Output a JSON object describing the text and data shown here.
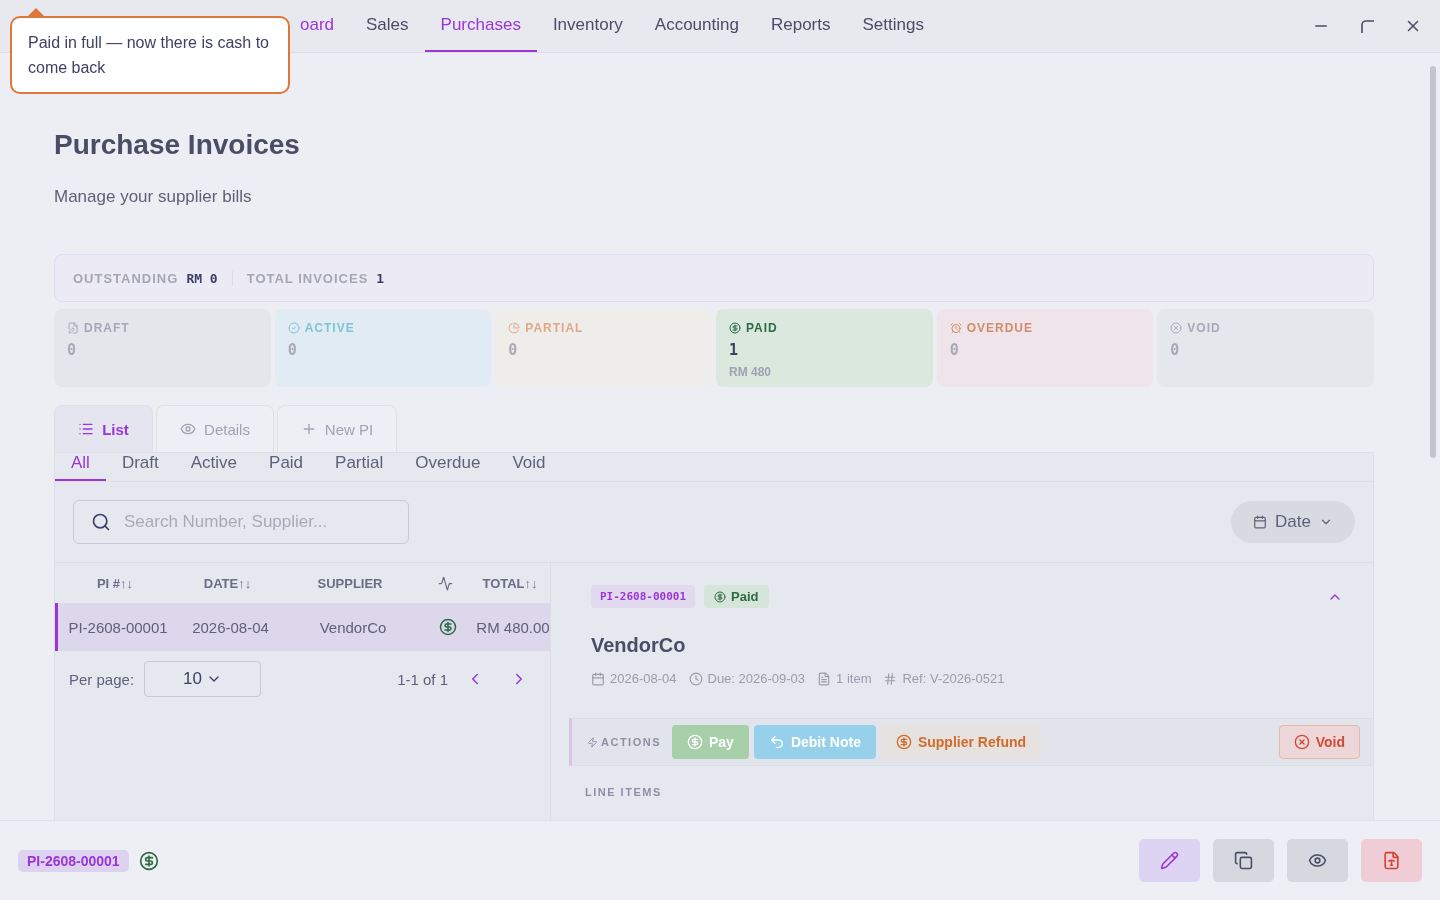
{
  "tooltip": {
    "text": "Paid in full — now there is cash to come back"
  },
  "nav": {
    "tabs": [
      {
        "label": "oard",
        "selected": false
      },
      {
        "label": "Sales",
        "selected": false
      },
      {
        "label": "Purchases",
        "selected": true
      },
      {
        "label": "Inventory",
        "selected": false
      },
      {
        "label": "Accounting",
        "selected": false
      },
      {
        "label": "Reports",
        "selected": false
      },
      {
        "label": "Settings",
        "selected": false
      }
    ]
  },
  "page": {
    "title": "Purchase Invoices",
    "subtitle": "Manage your supplier bills"
  },
  "summary": [
    {
      "label": "OUTSTANDING",
      "value": "RM 0"
    },
    {
      "label": "TOTAL INVOICES",
      "value": "1"
    }
  ],
  "status_cards": [
    {
      "kind": "draft",
      "label": "DRAFT",
      "count": "0",
      "color": "#a6a8b8"
    },
    {
      "kind": "active",
      "label": "ACTIVE",
      "count": "0",
      "color": "#7fc3d9"
    },
    {
      "kind": "partial",
      "label": "PARTIAL",
      "count": "0",
      "color": "#e0a888"
    },
    {
      "kind": "paid",
      "label": "PAID",
      "count": "1",
      "amount": "RM 480",
      "color": "#2e6a45"
    },
    {
      "kind": "overdue",
      "label": "OVERDUE",
      "count": "0",
      "color": "#d08c6c"
    },
    {
      "kind": "void",
      "label": "VOID",
      "count": "0",
      "color": "#a6a8b8"
    }
  ],
  "view_tabs": [
    {
      "kind": "list",
      "label": "List",
      "selected": true
    },
    {
      "kind": "details",
      "label": "Details",
      "selected": false
    },
    {
      "kind": "new",
      "label": "New PI",
      "selected": false
    }
  ],
  "filter_tabs": [
    {
      "label": "All",
      "selected": true
    },
    {
      "label": "Draft",
      "selected": false
    },
    {
      "label": "Active",
      "selected": false
    },
    {
      "label": "Paid",
      "selected": false
    },
    {
      "label": "Partial",
      "selected": false
    },
    {
      "label": "Overdue",
      "selected": false
    },
    {
      "label": "Void",
      "selected": false
    }
  ],
  "search": {
    "placeholder": "Search Number, Supplier..."
  },
  "date_button": {
    "label": "Date"
  },
  "table": {
    "columns": [
      {
        "kind": "text",
        "label": "PI #↑↓"
      },
      {
        "kind": "text",
        "label": "DATE↑↓"
      },
      {
        "kind": "text",
        "label": "SUPPLIER"
      },
      {
        "kind": "status"
      },
      {
        "kind": "text",
        "label": "TOTAL↑↓"
      }
    ],
    "rows": [
      {
        "number": "PI-2608-00001",
        "date": "2026-08-04",
        "supplier": "VendorCo",
        "paid": true,
        "total": "RM 480.00",
        "selected": true
      }
    ]
  },
  "pagination": {
    "label": "Per page:",
    "per_page": "10",
    "range": "1-1 of 1"
  },
  "detail": {
    "number": "PI-2608-00001",
    "status": {
      "kind": "paid",
      "label": "Paid"
    },
    "supplier": "VendorCo",
    "meta": [
      {
        "kind": "date",
        "text": "2026-08-04"
      },
      {
        "kind": "due",
        "text": "Due: 2026-09-03"
      },
      {
        "kind": "items",
        "text": "1 item"
      },
      {
        "kind": "ref",
        "text": "Ref: V-2026-0521"
      }
    ],
    "actions_label": "ACTIONS",
    "actions": [
      {
        "kind": "pay",
        "label": "Pay"
      },
      {
        "kind": "debit",
        "label": "Debit Note"
      },
      {
        "kind": "refund",
        "label": "Supplier Refund"
      },
      {
        "kind": "void",
        "label": "Void"
      }
    ],
    "line_items_label": "LINE ITEMS"
  },
  "footer": {
    "number": "PI-2608-00001",
    "paid": true,
    "buttons": [
      {
        "kind": "edit"
      },
      {
        "kind": "copy"
      },
      {
        "kind": "view"
      },
      {
        "kind": "pdf"
      }
    ]
  }
}
